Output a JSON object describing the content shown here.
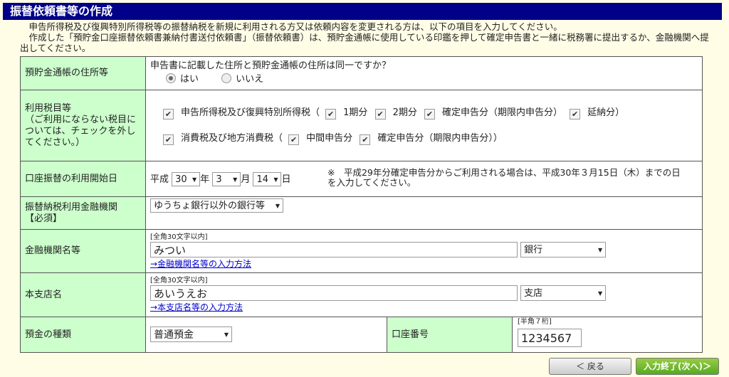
{
  "title": "振替依頼書等の作成",
  "intro": {
    "line1": "申告所得税及び復興特別所得税等の振替納税を新規に利用される方又は依頼内容を変更される方は、以下の項目を入力してください。",
    "line2": "作成した「預貯金口座振替依頼書兼納付書送付依頼書」（振替依頼書）は、預貯金通帳に使用している印鑑を押して確定申告書と一緒に税務署に提出するか、金融機関へ提出してください。"
  },
  "rows": {
    "address": {
      "label": "預貯金通帳の住所等",
      "question": "申告書に記載した住所と預貯金通帳の住所は同一ですか？",
      "yes": "はい",
      "no": "いいえ"
    },
    "tax": {
      "label": "利用税目等",
      "label_note": "（ご利用にならない税目については、チェックを外してください。）",
      "income": "申告所得税及び復興特別所得税（",
      "period1": "1期分",
      "period2": "2期分",
      "final": "確定申告分（期限内申告分）",
      "extended": "延納分）",
      "consumption": "消費税及び地方消費税（",
      "interim": "中間申告分",
      "final2": "確定申告分（期限内申告分））"
    },
    "start": {
      "label": "口座振替の利用開始日",
      "era": "平成",
      "year": "30",
      "year_unit": "年",
      "month": "3",
      "month_unit": "月",
      "day": "14",
      "day_unit": "日",
      "note": "※　平成29年分確定申告分からご利用される場合は、平成30年３月15日（木）までの日を入力してください。"
    },
    "bank_type": {
      "label": "振替納税利用金融機関",
      "required": "【必須】",
      "value": "ゆうちょ銀行以外の銀行等"
    },
    "bank_name": {
      "label": "金融機関名等",
      "limit": "[全角30文字以内]",
      "value": "みつい",
      "type": "銀行",
      "link": "→金融機関名等の入力方法"
    },
    "branch": {
      "label": "本支店名",
      "limit": "[全角30文字以内]",
      "value": "あいうえお",
      "type": "支店",
      "link": "→本支店名等の入力方法"
    },
    "deposit": {
      "label": "預金の種類",
      "value": "普通預金",
      "acct_label": "口座番号",
      "acct_limit": "[半角７桁]",
      "acct_value": "1234567"
    }
  },
  "buttons": {
    "back": "＜ 戻る",
    "next": "入力終了(次へ)＞"
  }
}
